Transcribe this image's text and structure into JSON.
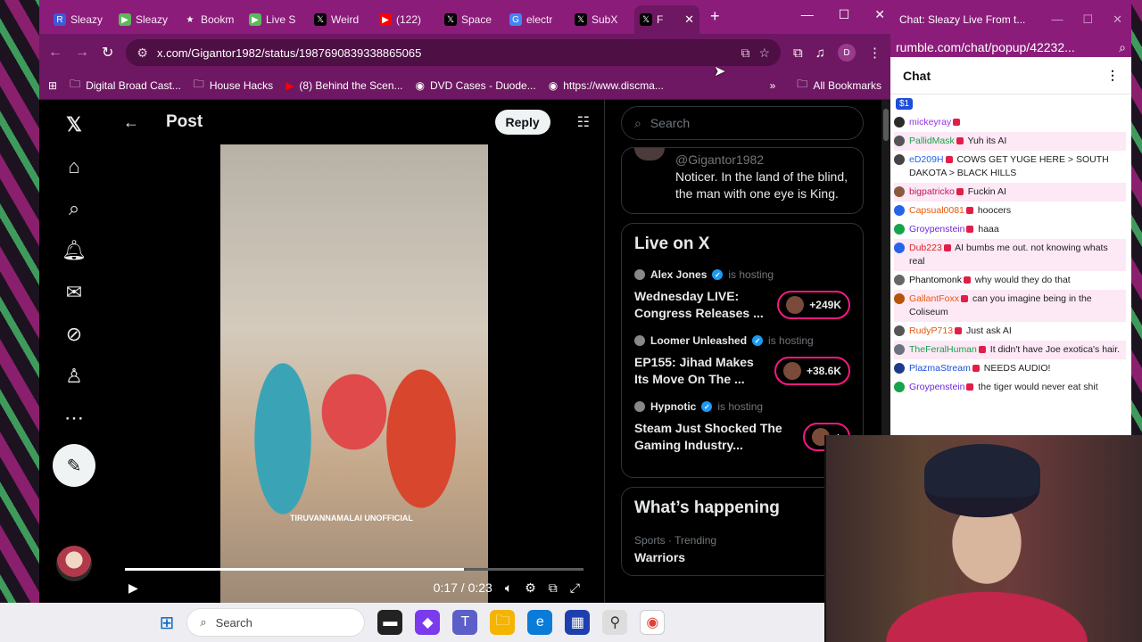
{
  "browser": {
    "tabs": [
      {
        "label": "Sleazy",
        "icon": "R",
        "icon_color": "#3b5bdb"
      },
      {
        "label": "Sleazy",
        "icon": "▶",
        "icon_color": "#5cb85c"
      },
      {
        "label": "Bookm",
        "icon": "★",
        "icon_color": "#8b1c7a"
      },
      {
        "label": "Live S",
        "icon": "▶",
        "icon_color": "#5cb85c"
      },
      {
        "label": "Weird",
        "icon": "𝕏",
        "icon_color": "#000000"
      },
      {
        "label": "(122)",
        "icon": "▶",
        "icon_color": "#ff0000"
      },
      {
        "label": "Space",
        "icon": "𝕏",
        "icon_color": "#000000"
      },
      {
        "label": "electr",
        "icon": "G",
        "icon_color": "#4285f4"
      },
      {
        "label": "SubX",
        "icon": "𝕏",
        "icon_color": "#000000"
      },
      {
        "label": "F",
        "icon": "𝕏",
        "icon_color": "#000000"
      }
    ],
    "url": "x.com/Gigantor1982/status/1987690839338865065",
    "bookmarks": [
      {
        "label": "Digital Broad Cast...",
        "icon": "folder"
      },
      {
        "label": "House Hacks",
        "icon": "folder"
      },
      {
        "label": "(8) Behind the Scen...",
        "icon": "youtube"
      },
      {
        "label": "DVD Cases - Duode...",
        "icon": "site"
      },
      {
        "label": "https://www.discma...",
        "icon": "site"
      }
    ],
    "all_bookmarks": "All Bookmarks",
    "profile_initial": "D"
  },
  "x": {
    "header_title": "Post",
    "reply_label": "Reply",
    "search_placeholder": "Search",
    "video": {
      "time": "0:17 / 0:23",
      "progress": 0.74,
      "watermark": "TIRUVANNAMALAI UNOFFICIAL"
    },
    "quote": {
      "handle": "@Gigantor1982",
      "text": "Noticer. In the land of the blind, the man with one eye is King."
    },
    "live": {
      "heading": "Live on X",
      "hosting_label": "is hosting",
      "items": [
        {
          "host": "Alex Jones",
          "title": "Wednesday LIVE: Congress Releases ...",
          "listeners": "+249K"
        },
        {
          "host": "Loomer Unleashed",
          "title": "EP155: Jihad Makes Its Move On The ...",
          "listeners": "+38.6K"
        },
        {
          "host": "Hypnotic",
          "title": "Steam Just Shocked The Gaming Industry...",
          "listeners": "+"
        }
      ]
    },
    "happening": {
      "heading": "What’s happening",
      "trend_meta": "Sports · Trending",
      "trend_name": "Warriors"
    }
  },
  "chat": {
    "window_title": "Chat: Sleazy Live From t...",
    "url": "rumble.com/chat/popup/42232...",
    "heading": "Chat",
    "rant": "$1",
    "messages": [
      {
        "user": "mickeyray",
        "text": "",
        "color": "#9333ea",
        "dot": "#2b2b2b",
        "hl": false
      },
      {
        "user": "PallidMask",
        "text": "Yuh its AI",
        "color": "#16a34a",
        "dot": "#555555",
        "hl": true
      },
      {
        "user": "eD209H",
        "text": "COWS GET YUGE HERE > SOUTH DAKOTA > BLACK HILLS",
        "color": "#2563eb",
        "dot": "#444444",
        "hl": false
      },
      {
        "user": "bigpatricko",
        "text": "Fuckin AI",
        "color": "#be185d",
        "dot": "#8b5a3c",
        "hl": true
      },
      {
        "user": "Capsual0081",
        "text": "hoocers",
        "color": "#ea580c",
        "dot": "#2563eb",
        "hl": false
      },
      {
        "user": "Groypenstein",
        "text": "haaa",
        "color": "#6d28d9",
        "dot": "#16a34a",
        "hl": false
      },
      {
        "user": "Dub223",
        "text": "AI bumbs me out. not knowing whats real",
        "color": "#dc2626",
        "dot": "#2563eb",
        "hl": true
      },
      {
        "user": "Phantomonk",
        "text": "why would they do that",
        "color": "#111111",
        "dot": "#666666",
        "hl": false
      },
      {
        "user": "GallantFoxx",
        "text": "can you imagine being in the Coliseum",
        "color": "#ea580c",
        "dot": "#b45309",
        "hl": true
      },
      {
        "user": "RudyP713",
        "text": "Just ask AI",
        "color": "#ea580c",
        "dot": "#555555",
        "hl": false
      },
      {
        "user": "TheFeralHuman",
        "text": "It didn't have Joe exotica's hair.",
        "color": "#16a34a",
        "dot": "#6b7280",
        "hl": true
      },
      {
        "user": "PlazmaStream",
        "text": "NEEDS AUDIO!",
        "color": "#1d4ed8",
        "dot": "#1e3a8a",
        "hl": false
      },
      {
        "user": "Groypenstein",
        "text": "the tiger would never eat shit",
        "color": "#6d28d9",
        "dot": "#16a34a",
        "hl": false
      }
    ]
  },
  "taskbar": {
    "search_placeholder": "Search"
  }
}
